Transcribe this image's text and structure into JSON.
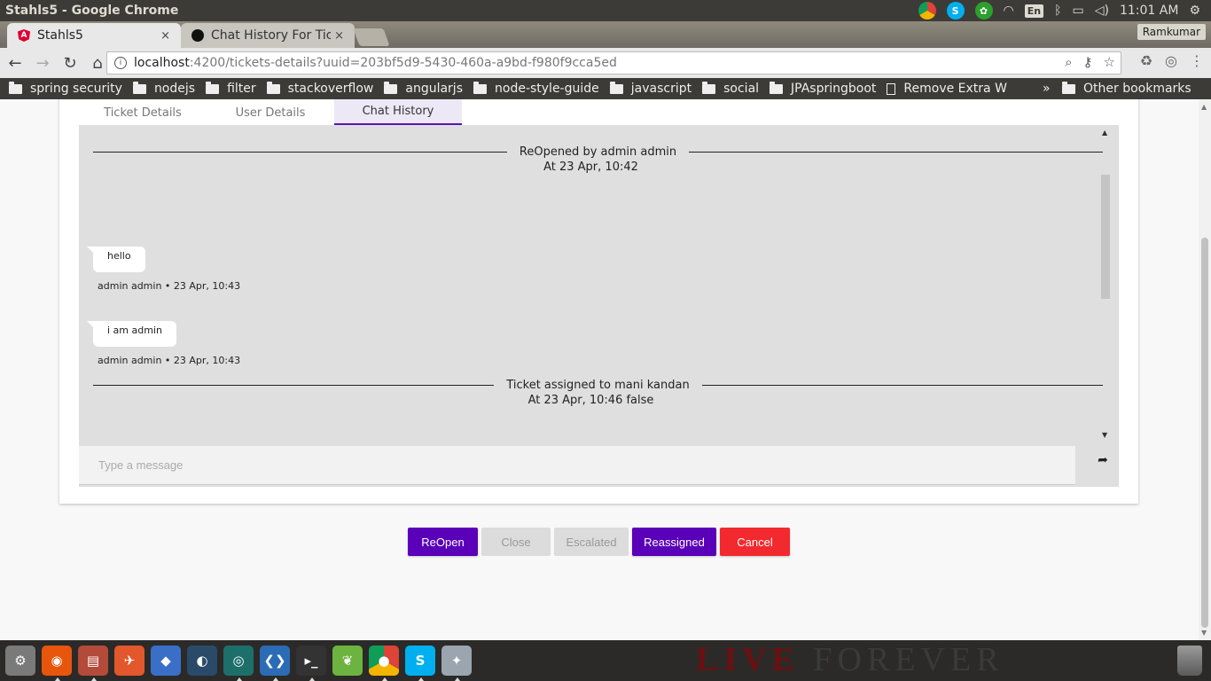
{
  "os": {
    "window_title": "Stahls5 - Google Chrome",
    "lang": "En",
    "time": "11:01 AM"
  },
  "browser": {
    "tabs": [
      {
        "title": "Stahls5",
        "close": "×"
      },
      {
        "title": "Chat History For Tic",
        "close": "×"
      }
    ],
    "profile": "Ramkumar",
    "url_host": "localhost",
    "url_path": ":4200/tickets-details?uuid=203bf5d9-5430-460a-a9bd-f980f9cca5ed",
    "bookmarks": [
      "spring security",
      "nodejs",
      "filter",
      "stackoverflow",
      "angularjs",
      "node-style-guide",
      "javascript",
      "social",
      "JPAspringboot",
      "Remove Extra W"
    ],
    "bookmarks_more": "»",
    "other_bookmarks": "Other bookmarks"
  },
  "ticket": {
    "tabs": [
      "Ticket Details",
      "User Details",
      "Chat History"
    ],
    "active_tab": 2,
    "chat": {
      "events": [
        {
          "text": "ReOpened by admin admin",
          "time": "At 23 Apr, 10:42"
        },
        {
          "text": "Ticket assigned to mani kandan",
          "time": "At 23 Apr, 10:46 false"
        }
      ],
      "messages": [
        {
          "text": "hello",
          "meta": "admin admin • 23 Apr, 10:43"
        },
        {
          "text": "i am admin",
          "meta": "admin admin • 23 Apr, 10:43"
        }
      ]
    },
    "input_placeholder": "Type a message",
    "actions": {
      "reopen": "ReOpen",
      "close": "Close",
      "escalated": "Escalated",
      "reassigned": "Reassigned",
      "cancel": "Cancel"
    }
  },
  "colors": {
    "primary": "#5a00b8",
    "danger": "#f2292e",
    "chat_bg": "#dfdfdf"
  },
  "dock": {
    "background_text_a": "LIVE",
    "background_text_b": "FOREVER"
  }
}
